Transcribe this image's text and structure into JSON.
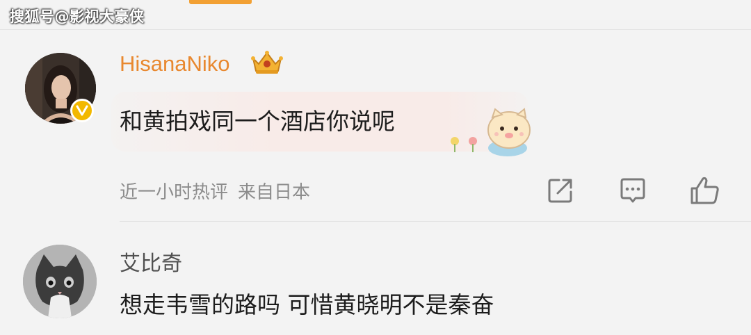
{
  "watermark": "搜狐号@影视大豪侠",
  "comments": [
    {
      "username": "HisanaNiko",
      "text": "和黄拍戏同一个酒店你说呢",
      "time": "近一小时热评",
      "location": "来自日本",
      "verified": true,
      "username_color": "#e8882f"
    },
    {
      "username": "艾比奇",
      "text": "想走韦雪的路吗 可惜黄晓明不是秦奋"
    }
  ],
  "icons": {
    "share": "share-icon",
    "comment": "comment-icon",
    "like": "thumbs-up-icon",
    "badge": "verified-badge-icon",
    "crown": "crown-icon"
  }
}
